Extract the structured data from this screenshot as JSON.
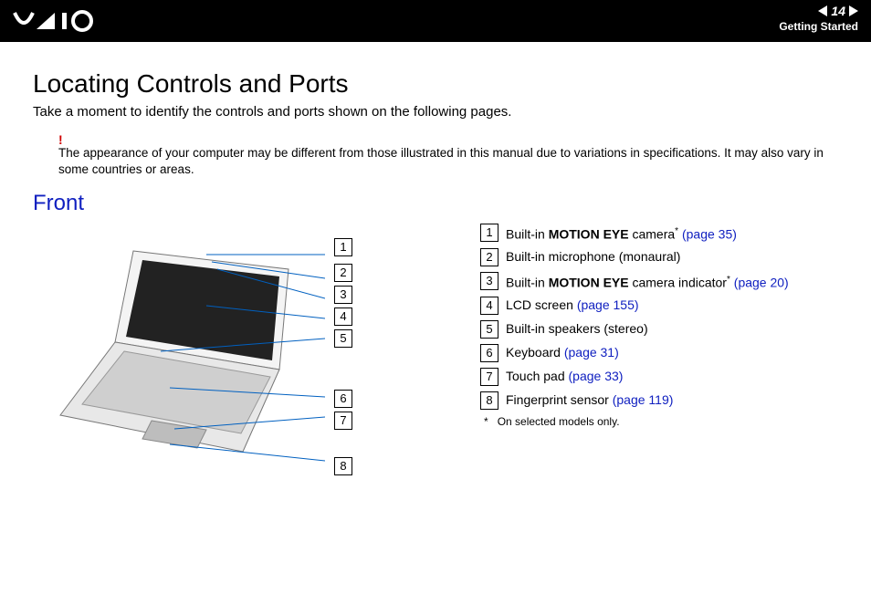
{
  "header": {
    "page_number": "14",
    "section": "Getting Started"
  },
  "title": "Locating Controls and Ports",
  "intro": "Take a moment to identify the controls and ports shown on the following pages.",
  "note_mark": "!",
  "note": "The appearance of your computer may be different from those illustrated in this manual due to variations in specifications. It may also vary in some countries or areas.",
  "subheading": "Front",
  "callout_numbers": [
    "1",
    "2",
    "3",
    "4",
    "5",
    "6",
    "7",
    "8"
  ],
  "items": [
    {
      "n": "1",
      "pre": "Built-in ",
      "bold": "MOTION EYE",
      "post": " camera",
      "star": "*",
      "link": "(page 35)"
    },
    {
      "n": "2",
      "pre": "Built-in microphone (monaural)",
      "bold": "",
      "post": "",
      "star": "",
      "link": ""
    },
    {
      "n": "3",
      "pre": "Built-in ",
      "bold": "MOTION EYE",
      "post": " camera indicator",
      "star": "*",
      "link": "(page 20)"
    },
    {
      "n": "4",
      "pre": "LCD screen ",
      "bold": "",
      "post": "",
      "star": "",
      "link": "(page 155)"
    },
    {
      "n": "5",
      "pre": "Built-in speakers (stereo)",
      "bold": "",
      "post": "",
      "star": "",
      "link": ""
    },
    {
      "n": "6",
      "pre": "Keyboard ",
      "bold": "",
      "post": "",
      "star": "",
      "link": "(page 31)"
    },
    {
      "n": "7",
      "pre": "Touch pad ",
      "bold": "",
      "post": "",
      "star": "",
      "link": "(page 33)"
    },
    {
      "n": "8",
      "pre": "Fingerprint sensor ",
      "bold": "",
      "post": "",
      "star": "",
      "link": "(page 119)"
    }
  ],
  "footnote_mark": "*",
  "footnote": "On selected models only."
}
